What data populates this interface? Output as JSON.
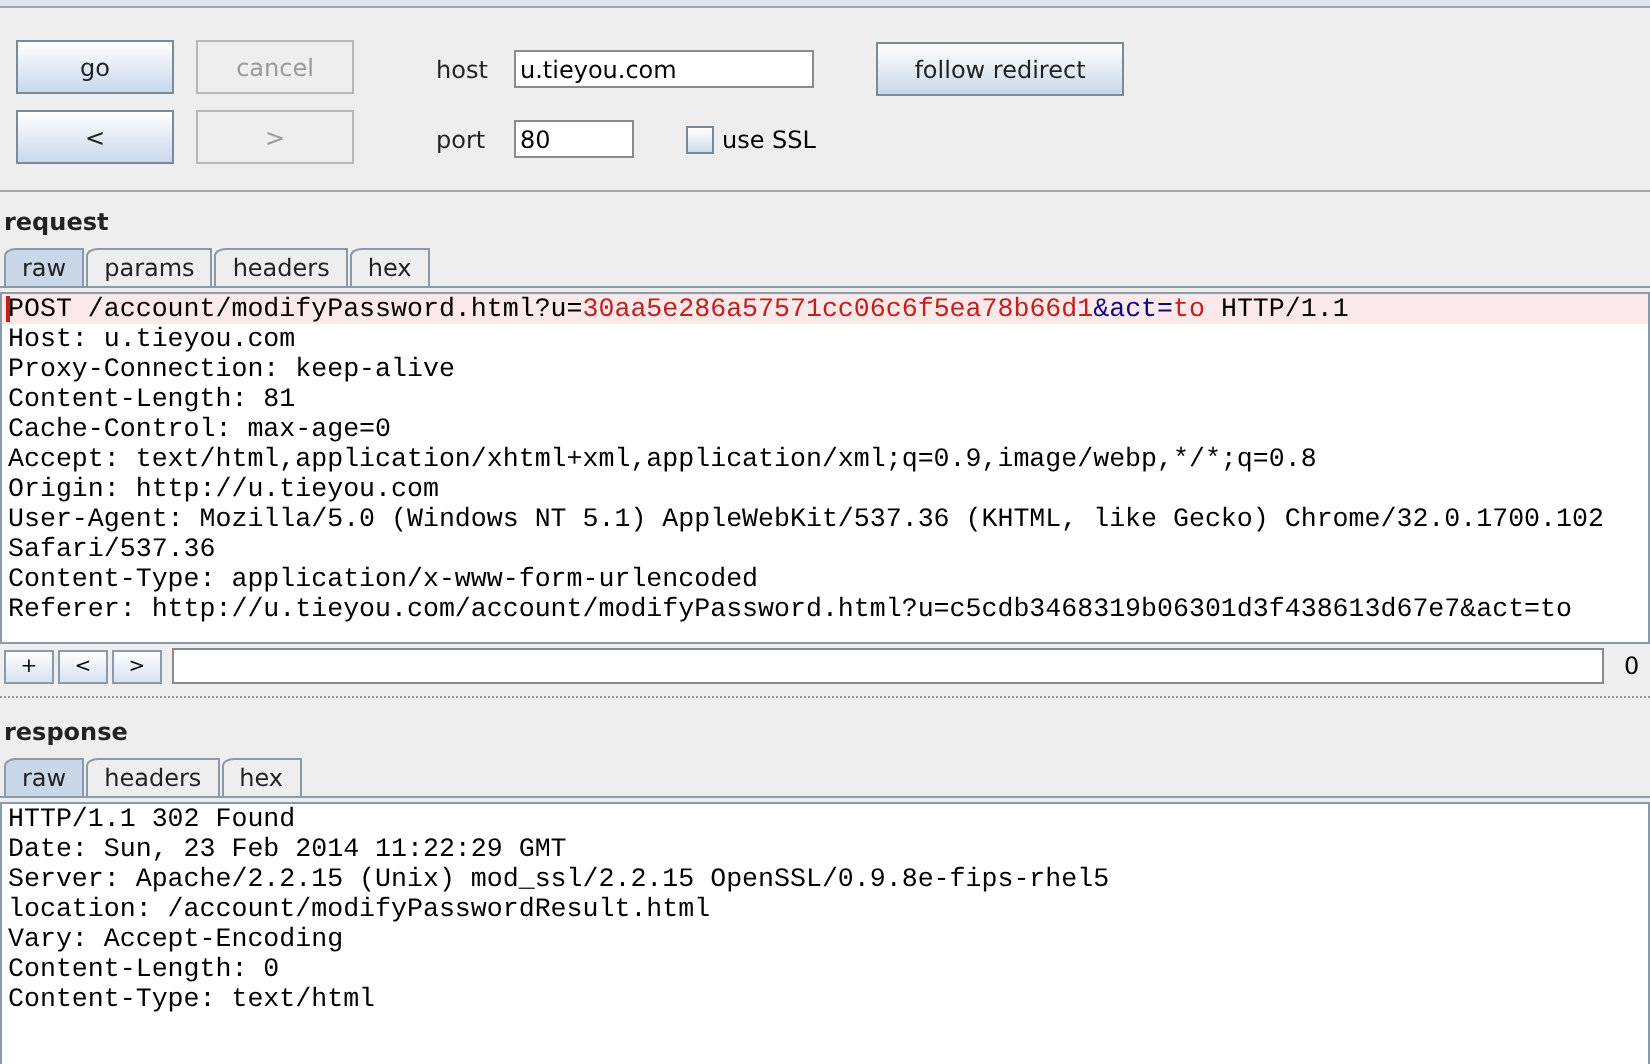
{
  "controls": {
    "buttons": [
      {
        "label": "go",
        "disabled": false
      },
      {
        "label": "cancel",
        "disabled": true
      },
      {
        "label": "<",
        "disabled": false
      },
      {
        "label": ">",
        "disabled": true
      }
    ],
    "host": {
      "label": "host",
      "value": "u.tieyou.com"
    },
    "follow_redirect": {
      "label": "follow redirect"
    },
    "port": {
      "label": "port",
      "value": "80"
    },
    "use_ssl": {
      "label": "use SSL",
      "checked": false
    }
  },
  "request": {
    "title": "request",
    "tabs": [
      {
        "label": "raw",
        "selected": true
      },
      {
        "label": "params",
        "selected": false
      },
      {
        "label": "headers",
        "selected": false
      },
      {
        "label": "hex",
        "selected": false
      }
    ],
    "lines": [
      {
        "current": true,
        "segments": [
          {
            "kind": "plain",
            "text": "POST /account/modifyPassword.html?u="
          },
          {
            "kind": "param-value",
            "text": "30aa5e286a57571cc06c6f5ea78b66d1"
          },
          {
            "kind": "param-name",
            "text": "&act="
          },
          {
            "kind": "param-value",
            "text": "to"
          },
          {
            "kind": "plain",
            "text": " HTTP/1.1"
          }
        ]
      },
      {
        "current": false,
        "segments": [
          {
            "kind": "plain",
            "text": "Host: u.tieyou.com"
          }
        ]
      },
      {
        "current": false,
        "segments": [
          {
            "kind": "plain",
            "text": "Proxy-Connection: keep-alive"
          }
        ]
      },
      {
        "current": false,
        "segments": [
          {
            "kind": "plain",
            "text": "Content-Length: 81"
          }
        ]
      },
      {
        "current": false,
        "segments": [
          {
            "kind": "plain",
            "text": "Cache-Control: max-age=0"
          }
        ]
      },
      {
        "current": false,
        "segments": [
          {
            "kind": "plain",
            "text": "Accept: text/html,application/xhtml+xml,application/xml;q=0.9,image/webp,*/*;q=0.8"
          }
        ]
      },
      {
        "current": false,
        "segments": [
          {
            "kind": "plain",
            "text": "Origin: http://u.tieyou.com"
          }
        ]
      },
      {
        "current": false,
        "segments": [
          {
            "kind": "plain",
            "text": "User-Agent: Mozilla/5.0 (Windows NT 5.1) AppleWebKit/537.36 (KHTML, like Gecko) Chrome/32.0.1700.102"
          }
        ]
      },
      {
        "current": false,
        "segments": [
          {
            "kind": "plain",
            "text": "Safari/537.36"
          }
        ]
      },
      {
        "current": false,
        "segments": [
          {
            "kind": "plain",
            "text": "Content-Type: application/x-www-form-urlencoded"
          }
        ]
      },
      {
        "current": false,
        "segments": [
          {
            "kind": "plain",
            "text": "Referer: http://u.tieyou.com/account/modifyPassword.html?u=c5cdb3468319b06301d3f438613d67e7&act=to"
          }
        ]
      }
    ],
    "search_buttons": [
      "+",
      "<",
      ">"
    ],
    "match_count": "0"
  },
  "response": {
    "title": "response",
    "tabs": [
      {
        "label": "raw",
        "selected": true
      },
      {
        "label": "headers",
        "selected": false
      },
      {
        "label": "hex",
        "selected": false
      }
    ],
    "lines": [
      "HTTP/1.1 302 Found",
      "Date: Sun, 23 Feb 2014 11:22:29 GMT",
      "Server: Apache/2.2.15 (Unix) mod_ssl/2.2.15 OpenSSL/0.9.8e-fips-rhel5",
      "location: /account/modifyPasswordResult.html",
      "Vary: Accept-Encoding",
      "Content-Length: 0",
      "Content-Type: text/html"
    ]
  }
}
